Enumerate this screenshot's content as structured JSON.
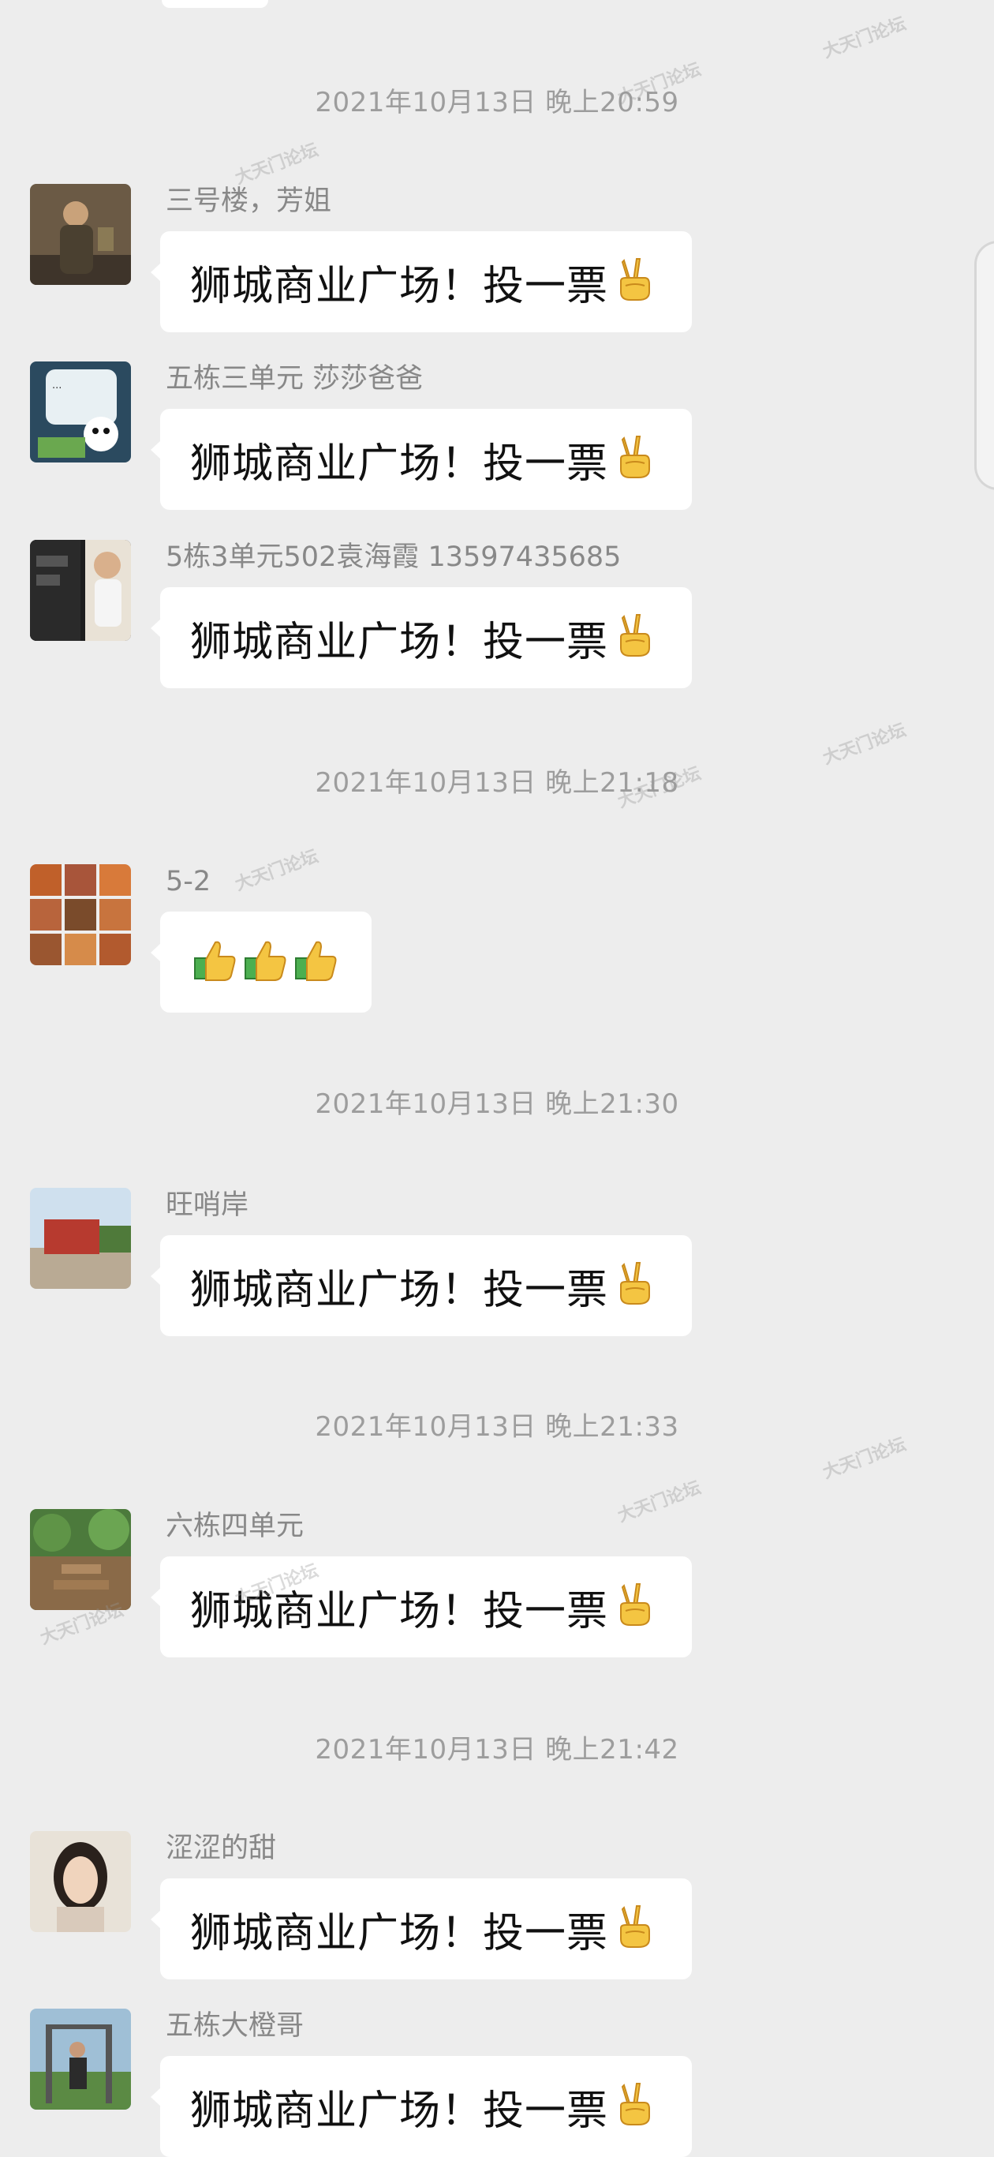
{
  "watermark_text": "大天门论坛",
  "timestamps": [
    "2021年10月13日 晚上20:59",
    "2021年10月13日 晚上21:18",
    "2021年10月13日 晚上21:30",
    "2021年10月13日 晚上21:33",
    "2021年10月13日 晚上21:42"
  ],
  "messages": [
    {
      "sender": "三号楼，芳姐",
      "text": "狮城商业广场！投一票",
      "emoji": "victory-hand-icon"
    },
    {
      "sender": "五栋三单元 莎莎爸爸",
      "text": "狮城商业广场！投一票",
      "emoji": "victory-hand-icon"
    },
    {
      "sender": "5栋3单元502袁海霞 13597435685",
      "text": "狮城商业广场！投一票",
      "emoji": "victory-hand-icon"
    },
    {
      "sender": "5-2",
      "text": "",
      "emoji": "thumbs-up-icon"
    },
    {
      "sender": "旺哨岸",
      "text": "狮城商业广场！投一票",
      "emoji": "victory-hand-icon"
    },
    {
      "sender": "六栋四单元",
      "text": "狮城商业广场！投一票",
      "emoji": "victory-hand-icon"
    },
    {
      "sender": "涩涩的甜",
      "text": "狮城商业广场！投一票",
      "emoji": "victory-hand-icon"
    },
    {
      "sender": "五栋大橙哥",
      "text": "狮城商业广场！投一票",
      "emoji": "victory-hand-icon"
    }
  ],
  "colors": {
    "background": "#ededed",
    "bubble": "#ffffff",
    "timestamp": "#9d9d9d",
    "sender": "#888888"
  }
}
